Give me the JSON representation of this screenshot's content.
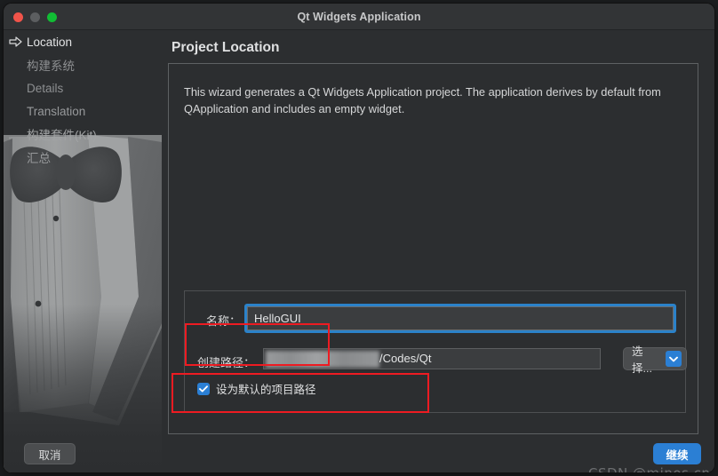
{
  "window": {
    "title": "Qt Widgets Application",
    "controls": {
      "close": "close-button",
      "minimize": "minimize-button",
      "zoom": "zoom-button"
    }
  },
  "sidebar": {
    "items": [
      {
        "label": "Location",
        "state": "active",
        "icon": "arrow-right-icon"
      },
      {
        "label": "构建系统",
        "state": "upcoming",
        "icon": ""
      },
      {
        "label": "Details",
        "state": "upcoming",
        "icon": ""
      },
      {
        "label": "Translation",
        "state": "upcoming",
        "icon": ""
      },
      {
        "label": "构建套件(Kit)",
        "state": "upcoming",
        "icon": ""
      },
      {
        "label": "汇总",
        "state": "upcoming",
        "icon": ""
      }
    ],
    "background_art": "tuxedo-bowtie-illustration"
  },
  "main": {
    "page_title": "Project Location",
    "description": "This wizard generates a Qt Widgets Application project. The application derives by default from QApplication and includes an empty widget.",
    "form": {
      "name": {
        "label": "名称：",
        "value": "HelloGUI",
        "placeholder": "",
        "focused": true,
        "focus_color": "#2b82c9"
      },
      "path": {
        "label": "创建路径：",
        "value": "/Codes/Qt",
        "redacted_prefix": true,
        "browse_button": {
          "label": "选择...",
          "chevron_icon": "chevron-down-icon",
          "chevron_color": "#2b7fd4"
        }
      },
      "default_path_checkbox": {
        "label": "设为默认的项目路径",
        "checked": true,
        "color": "#2b7fd4"
      }
    }
  },
  "footer": {
    "cancel_label": "取消",
    "next_label": "继续",
    "next_color": "#2b7fd4",
    "watermark": "CSDN @minos.cpp"
  },
  "annotations": [
    {
      "name": "name-field-highlight",
      "color": "#ee1b22"
    },
    {
      "name": "path-field-highlight",
      "color": "#ee1b22"
    }
  ]
}
